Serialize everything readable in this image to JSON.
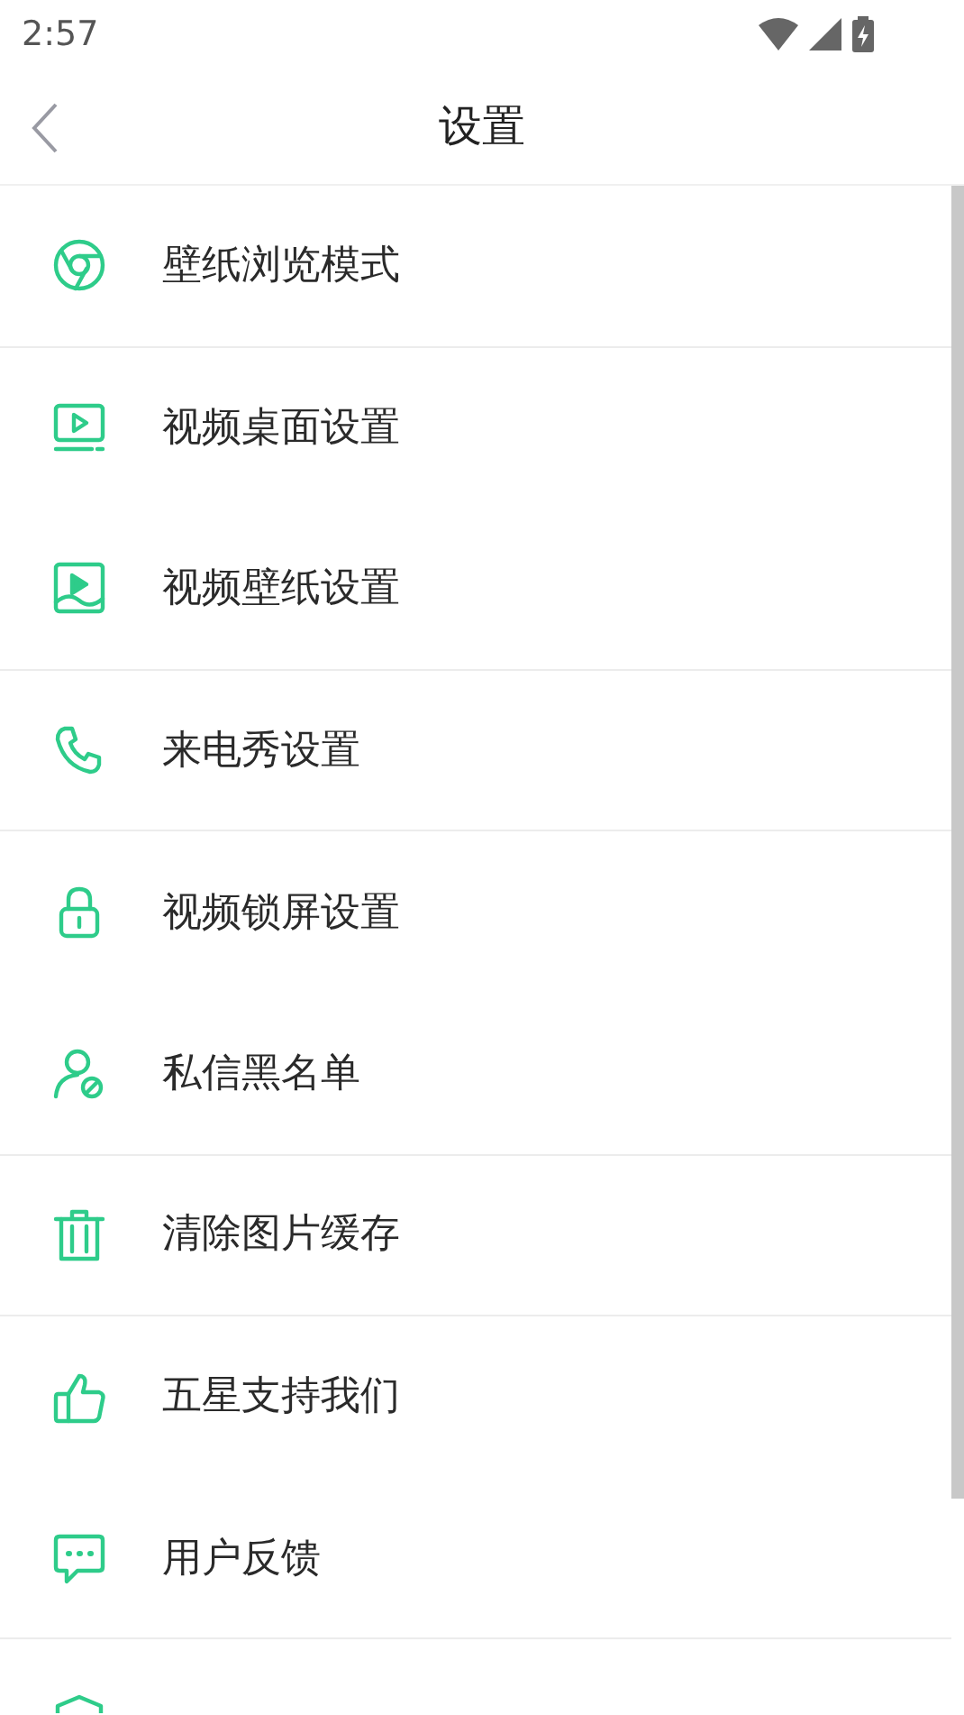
{
  "status_bar": {
    "time": "2:57"
  },
  "header": {
    "title": "设置"
  },
  "items": [
    {
      "label": "壁纸浏览模式",
      "divider_below": true
    },
    {
      "label": "视频桌面设置",
      "divider_below": false
    },
    {
      "label": "视频壁纸设置",
      "divider_below": true
    },
    {
      "label": "来电秀设置",
      "divider_below": true
    },
    {
      "label": "视频锁屏设置",
      "divider_below": false
    },
    {
      "label": "私信黑名单",
      "divider_below": true
    },
    {
      "label": "清除图片缓存",
      "divider_below": true
    },
    {
      "label": "五星支持我们",
      "divider_below": false
    },
    {
      "label": "用户反馈",
      "divider_below": true
    },
    {
      "kind": "partial"
    }
  ]
}
